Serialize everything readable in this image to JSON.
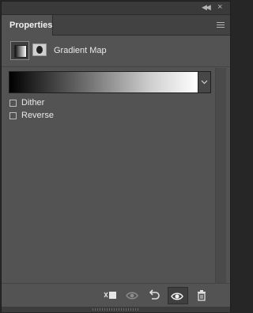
{
  "panel": {
    "tab_label": "Properties",
    "adjustment_title": "Gradient Map",
    "gradient_menu_icon": "chevron-down-icon"
  },
  "options": {
    "dither_label": "Dither",
    "dither_checked": false,
    "reverse_label": "Reverse",
    "reverse_checked": false
  },
  "bottom_bar": {
    "buttons": [
      "clip-to-layer-icon",
      "view-previous-state-icon",
      "reset-icon",
      "visibility-icon",
      "trash-icon"
    ]
  },
  "colors": {
    "panel_bg": "#535353",
    "gradient_start": "#000000",
    "gradient_end": "#ffffff"
  }
}
